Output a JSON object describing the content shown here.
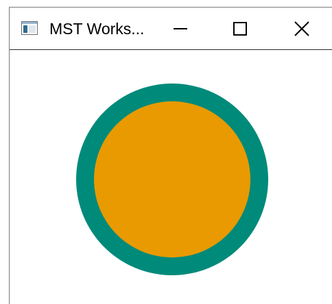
{
  "window": {
    "title": "MST Works...",
    "controls": {
      "minimize": "minimize",
      "maximize": "maximize",
      "close": "close"
    }
  },
  "canvas": {
    "shape": "ring",
    "outer_color": "#008a7a",
    "inner_color": "#e89a00",
    "background": "#ffffff"
  }
}
